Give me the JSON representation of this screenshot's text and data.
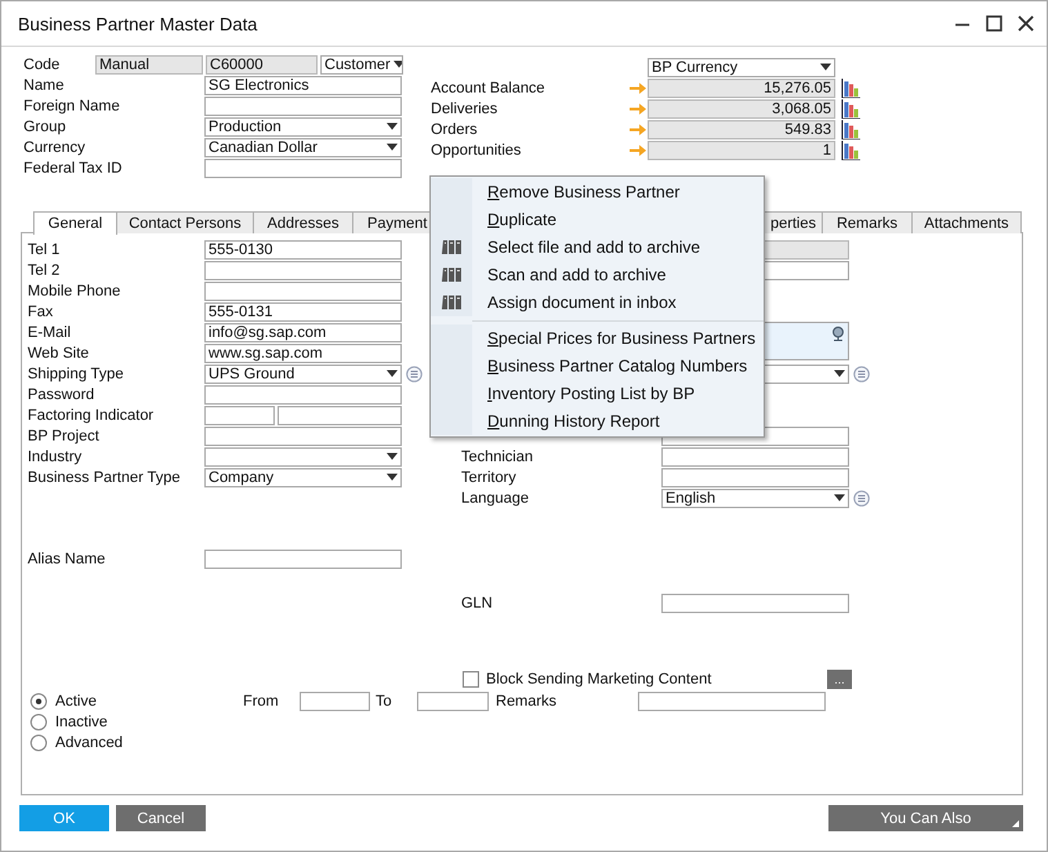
{
  "window": {
    "title": "Business Partner Master Data"
  },
  "header": {
    "left": [
      {
        "label": "Code",
        "kind": "code",
        "series": "Manual",
        "value": "C60000",
        "type": "Customer"
      },
      {
        "label": "Name",
        "kind": "text",
        "value": "SG Electronics"
      },
      {
        "label": "Foreign Name",
        "kind": "text"
      },
      {
        "label": "Group",
        "kind": "dropdown",
        "value": "Production"
      },
      {
        "label": "Currency",
        "kind": "dropdown",
        "value": "Canadian Dollar"
      },
      {
        "label": "Federal Tax ID",
        "kind": "text"
      }
    ],
    "currency": "BP Currency",
    "balances": [
      {
        "label": "Account Balance",
        "value": "15,276.05"
      },
      {
        "label": "Deliveries",
        "value": "3,068.05"
      },
      {
        "label": "Orders",
        "value": "549.83"
      },
      {
        "label": "Opportunities",
        "value": "1"
      }
    ]
  },
  "tabs": [
    {
      "label": "General",
      "selected": true
    },
    {
      "label": "Contact Persons",
      "selected": false
    },
    {
      "label": "Addresses",
      "selected": false
    },
    {
      "label": "Payment",
      "selected": false
    },
    {
      "label": "perties",
      "selected": false
    },
    {
      "label": "Remarks",
      "selected": false
    },
    {
      "label": "Attachments",
      "selected": false
    }
  ],
  "general": {
    "left": [
      {
        "label": "Tel 1",
        "kind": "text",
        "value": "555-0130"
      },
      {
        "label": "Tel 2",
        "kind": "text"
      },
      {
        "label": "Mobile Phone",
        "kind": "text"
      },
      {
        "label": "Fax",
        "kind": "text",
        "value": "555-0131"
      },
      {
        "label": "E-Mail",
        "kind": "text",
        "value": "info@sg.sap.com"
      },
      {
        "label": "Web Site",
        "kind": "text",
        "value": "www.sg.sap.com"
      },
      {
        "label": "Shipping Type",
        "kind": "dropdown",
        "value": "UPS Ground",
        "list": true
      },
      {
        "label": "Password",
        "kind": "text"
      },
      {
        "label": "Factoring Indicator",
        "kind": "split"
      },
      {
        "label": "BP Project",
        "kind": "text"
      },
      {
        "label": "Industry",
        "kind": "dropdown"
      },
      {
        "label": "Business Partner Type",
        "kind": "dropdown",
        "value": "Company"
      },
      {
        "label": "Alias Name",
        "kind": "text"
      }
    ],
    "right": [
      {
        "kind": "grey"
      },
      {
        "kind": "text"
      },
      {
        "kind": "textarea"
      },
      {
        "kind": "dropdown",
        "list": true
      },
      {
        "kind": "text"
      },
      {
        "label": "Technician",
        "kind": "text"
      },
      {
        "label": "Territory",
        "kind": "text"
      },
      {
        "label": "Language",
        "kind": "dropdown",
        "value": "English",
        "list": true
      },
      {
        "label": "GLN",
        "kind": "text"
      }
    ],
    "block_marketing": {
      "label": "Block Sending Marketing Content",
      "checked": false,
      "more": "..."
    },
    "status": [
      {
        "label": "Active",
        "selected": true
      },
      {
        "label": "Inactive",
        "selected": false
      },
      {
        "label": "Advanced",
        "selected": false
      }
    ],
    "from_label": "From",
    "to_label": "To",
    "remarks_label": "Remarks"
  },
  "buttons": {
    "ok": "OK",
    "cancel": "Cancel",
    "more": "You Can Also"
  },
  "menu": {
    "groups": [
      [
        {
          "label": "Remove Business Partner",
          "icon": false,
          "mnemonic": true
        },
        {
          "label": "Duplicate",
          "icon": false,
          "mnemonic": true
        },
        {
          "label": "Select file and add to archive",
          "icon": true,
          "mnemonic": false
        },
        {
          "label": "Scan and add to archive",
          "icon": true,
          "mnemonic": false
        },
        {
          "label": "Assign document in inbox",
          "icon": true,
          "mnemonic": false
        }
      ],
      [
        {
          "label": "Special Prices for Business Partners",
          "icon": false,
          "mnemonic": true
        },
        {
          "label": "Business Partner Catalog Numbers",
          "icon": false,
          "mnemonic": true
        },
        {
          "label": "Inventory Posting List by BP",
          "icon": false,
          "mnemonic": true
        },
        {
          "label": "Dunning History Report",
          "icon": false,
          "mnemonic": true
        }
      ]
    ]
  }
}
